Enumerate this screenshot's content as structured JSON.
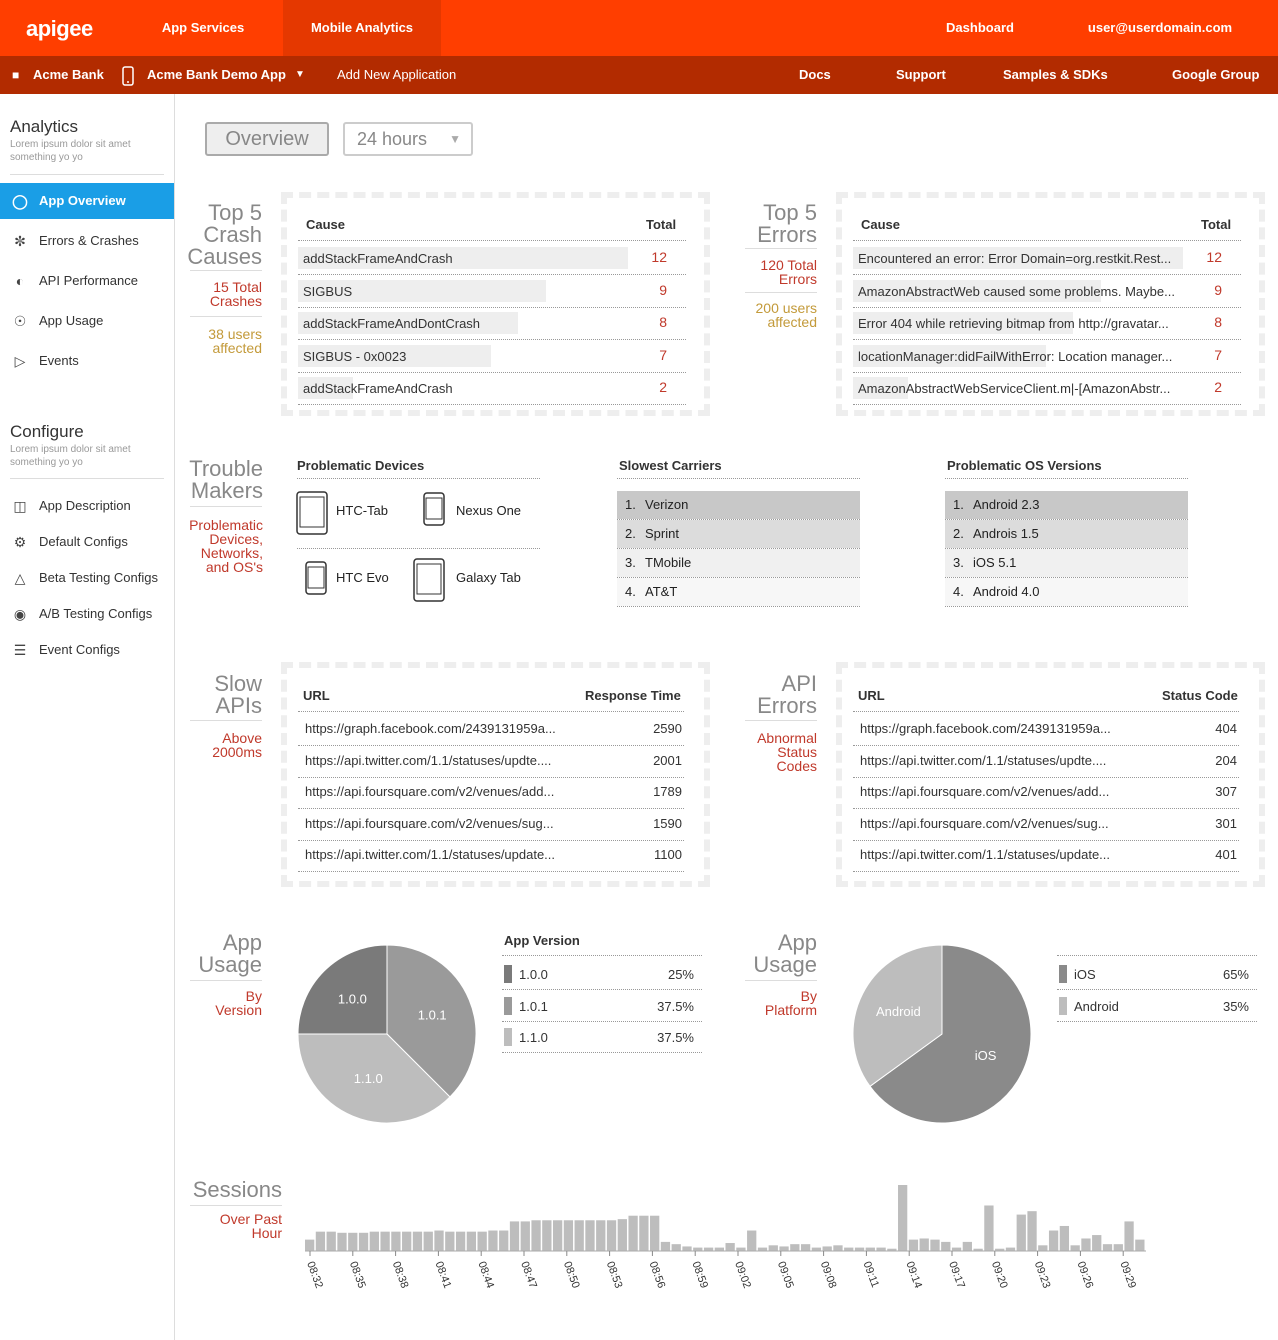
{
  "header": {
    "logo": "apigee",
    "nav": [
      "App Services",
      "Mobile Analytics"
    ],
    "right": [
      "Dashboard",
      "user@userdomain.com"
    ]
  },
  "subheader": {
    "org": "Acme Bank",
    "app": "Acme Bank Demo App",
    "add": "Add New Application",
    "links": [
      "Docs",
      "Support",
      "Samples & SDKs",
      "Google Group"
    ]
  },
  "sidebar": {
    "analytics_title": "Analytics",
    "analytics_sub": "Lorem ipsum dolor sit amet something yo yo",
    "analytics_items": [
      {
        "label": "App Overview",
        "icon": "bulb-icon"
      },
      {
        "label": "Errors & Crashes",
        "icon": "bomb-icon"
      },
      {
        "label": "API Performance",
        "icon": "gauge-icon"
      },
      {
        "label": "App Usage",
        "icon": "user-icon"
      },
      {
        "label": "Events",
        "icon": "megaphone-icon"
      }
    ],
    "configure_title": "Configure",
    "configure_sub": "Lorem ipsum dolor sit amet something yo yo",
    "configure_items": [
      {
        "label": "App Description",
        "icon": "tag-icon"
      },
      {
        "label": "Default Configs",
        "icon": "gear-icon"
      },
      {
        "label": "Beta Testing Configs",
        "icon": "flask-icon"
      },
      {
        "label": "A/B Testing Configs",
        "icon": "eye-icon"
      },
      {
        "label": "Event Configs",
        "icon": "sliders-icon"
      }
    ]
  },
  "toolbar": {
    "overview": "Overview",
    "range": "24 hours"
  },
  "crash": {
    "title1": "Top 5",
    "title2": "Crash",
    "title3": "Causes",
    "total1": "15 Total",
    "total2": "Crashes",
    "users1": "38 users",
    "users2": "affected",
    "col_cause": "Cause",
    "col_total": "Total",
    "rows": [
      {
        "cause": "addStackFrameAndCrash",
        "total": 12
      },
      {
        "cause": "SIGBUS",
        "total": 9
      },
      {
        "cause": "addStackFrameAndDontCrash",
        "total": 8
      },
      {
        "cause": "SIGBUS - 0x0023",
        "total": 7
      },
      {
        "cause": "addStackFrameAndCrash",
        "total": 2
      }
    ]
  },
  "errors": {
    "title1": "Top 5",
    "title2": "Errors",
    "total1": "120 Total",
    "total2": "Errors",
    "users1": "200 users",
    "users2": "affected",
    "col_cause": "Cause",
    "col_total": "Total",
    "rows": [
      {
        "cause": "Encountered an error: Error Domain=org.restkit.Rest...",
        "total": 12
      },
      {
        "cause": "AmazonAbstractWeb caused some problems. Maybe...",
        "total": 9
      },
      {
        "cause": "Error 404 while retrieving bitmap from http://gravatar...",
        "total": 8
      },
      {
        "cause": "locationManager:didFailWithError: Location manager...",
        "total": 7
      },
      {
        "cause": "AmazonAbstractWebServiceClient.m|-[AmazonAbstr...",
        "total": 2
      }
    ]
  },
  "trouble": {
    "title1": "Trouble",
    "title2": "Makers",
    "sub1": "Problematic",
    "sub2": "Devices,",
    "sub3": "Networks,",
    "sub4": "and OS's",
    "devices_title": "Problematic Devices",
    "devices": [
      {
        "name": "HTC-Tab",
        "icon": "tablet-icon"
      },
      {
        "name": "Nexus One",
        "icon": "phone-icon"
      },
      {
        "name": "HTC Evo",
        "icon": "phone-icon"
      },
      {
        "name": "Galaxy Tab",
        "icon": "tablet-icon"
      }
    ],
    "carriers_title": "Slowest Carriers",
    "carriers": [
      "Verizon",
      "Sprint",
      "TMobile",
      "AT&T"
    ],
    "os_title": "Problematic OS Versions",
    "os": [
      "Android 2.3",
      "Androis 1.5",
      "iOS 5.1",
      "Android 4.0"
    ],
    "ranks": [
      "1.",
      "2.",
      "3.",
      "4."
    ]
  },
  "slow_apis": {
    "title1": "Slow",
    "title2": "APIs",
    "sub1": "Above",
    "sub2": "2000ms",
    "col_url": "URL",
    "col_val": "Response Time",
    "rows": [
      {
        "url": "https://graph.facebook.com/2439131959a...",
        "val": "2590"
      },
      {
        "url": "https://api.twitter.com/1.1/statuses/updte....",
        "val": "2001"
      },
      {
        "url": "https://api.foursquare.com/v2/venues/add...",
        "val": "1789"
      },
      {
        "url": "https://api.foursquare.com/v2/venues/sug...",
        "val": "1590"
      },
      {
        "url": "https://api.twitter.com/1.1/statuses/update...",
        "val": "1100"
      }
    ]
  },
  "api_errors": {
    "title1": "API",
    "title2": "Errors",
    "sub1": "Abnormal",
    "sub2": "Status",
    "sub3": "Codes",
    "col_url": "URL",
    "col_val": "Status Code",
    "rows": [
      {
        "url": "https://graph.facebook.com/2439131959a...",
        "val": "404"
      },
      {
        "url": "https://api.twitter.com/1.1/statuses/updte....",
        "val": "204"
      },
      {
        "url": "https://api.foursquare.com/v2/venues/add...",
        "val": "307"
      },
      {
        "url": "https://api.foursquare.com/v2/venues/sug...",
        "val": "301"
      },
      {
        "url": "https://api.twitter.com/1.1/statuses/update...",
        "val": "401"
      }
    ]
  },
  "usage_version": {
    "title1": "App",
    "title2": "Usage",
    "sub1": "By",
    "sub2": "Version",
    "legend_title": "App Version",
    "legend": [
      {
        "label": "1.0.0",
        "pct": "25%"
      },
      {
        "label": "1.0.1",
        "pct": "37.5%"
      },
      {
        "label": "1.1.0",
        "pct": "37.5%"
      }
    ]
  },
  "usage_platform": {
    "title1": "App",
    "title2": "Usage",
    "sub1": "By",
    "sub2": "Platform",
    "legend": [
      {
        "label": "iOS",
        "pct": "65%"
      },
      {
        "label": "Android",
        "pct": "35%"
      }
    ]
  },
  "sessions": {
    "title": "Sessions",
    "sub1": "Over Past",
    "sub2": "Hour"
  },
  "colors": {
    "brand": "#ff3e00",
    "brand_dark": "#b22b00",
    "active": "#1a9ee6",
    "red_text": "#c0392b",
    "gold_text": "#c39a3a"
  },
  "chart_data": [
    {
      "type": "pie",
      "categories": [
        "1.0.0",
        "1.0.1",
        "1.1.0"
      ],
      "values": [
        25,
        37.5,
        37.5
      ]
    },
    {
      "type": "pie",
      "categories": [
        "iOS",
        "Android"
      ],
      "values": [
        65,
        35
      ]
    },
    {
      "type": "bar",
      "x": [
        "08:32",
        "08:35",
        "08:38",
        "08:41",
        "08:44",
        "08:47",
        "08:50",
        "08:53",
        "08:56",
        "08:59",
        "09:02",
        "09:05",
        "09:08",
        "09:11",
        "09:14",
        "09:17",
        "09:20",
        "09:23",
        "09:26",
        "09:29"
      ],
      "values": [
        10,
        17,
        17,
        16,
        16,
        16,
        17,
        17,
        17,
        17,
        17,
        17,
        18,
        17,
        17,
        17,
        17,
        18,
        18,
        26,
        26,
        27,
        27,
        27,
        27,
        27,
        27,
        27,
        27,
        28,
        31,
        31,
        31,
        8,
        6,
        4,
        3,
        3,
        3,
        7,
        3,
        18,
        3,
        5,
        4,
        6,
        6,
        3,
        4,
        5,
        3,
        3,
        3,
        3,
        2,
        58,
        10,
        11,
        10,
        8,
        3,
        8,
        2,
        40,
        2,
        3,
        32,
        35,
        5,
        18,
        22,
        5,
        11,
        14,
        6,
        6,
        26,
        10
      ],
      "tick_labels": [
        "08:32",
        "08:35",
        "08:38",
        "08:41",
        "08:44",
        "08:47",
        "08:50",
        "08:53",
        "08:56",
        "08:59",
        "09:02",
        "09:05",
        "09:08",
        "09:11",
        "09:14",
        "09:17",
        "09:20",
        "09:23",
        "09:26",
        "09:29"
      ]
    }
  ]
}
